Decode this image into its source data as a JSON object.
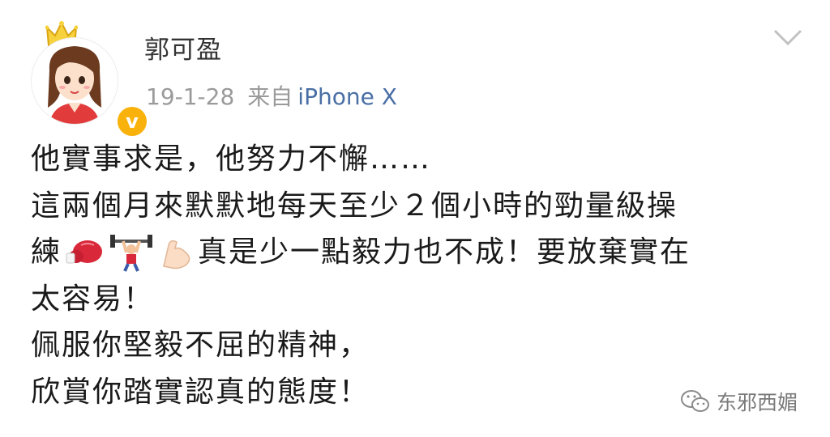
{
  "post": {
    "username": "郭可盈",
    "date": "19-1-28",
    "from_label": "来自",
    "source": "iPhone X"
  },
  "content": {
    "line1": "他實事求是，他努力不懈……",
    "line2": "這兩個月來默默地每天至少２個小時的勁量級操",
    "line3_prefix": "練",
    "line3_suffix": "真是少一點毅力也不成！要放棄實在",
    "line4": "太容易！",
    "line5": "佩服你堅毅不屈的精神，",
    "line6": "欣賞你踏實認真的態度！",
    "emojis": [
      "boxing-glove-icon",
      "weightlifter-icon",
      "flexed-biceps-icon"
    ]
  },
  "watermark": {
    "text": "东邪西媚"
  },
  "colors": {
    "link": "#4a6fa5",
    "meta": "#9a9a9a",
    "verified_badge": "#f8b20b"
  }
}
